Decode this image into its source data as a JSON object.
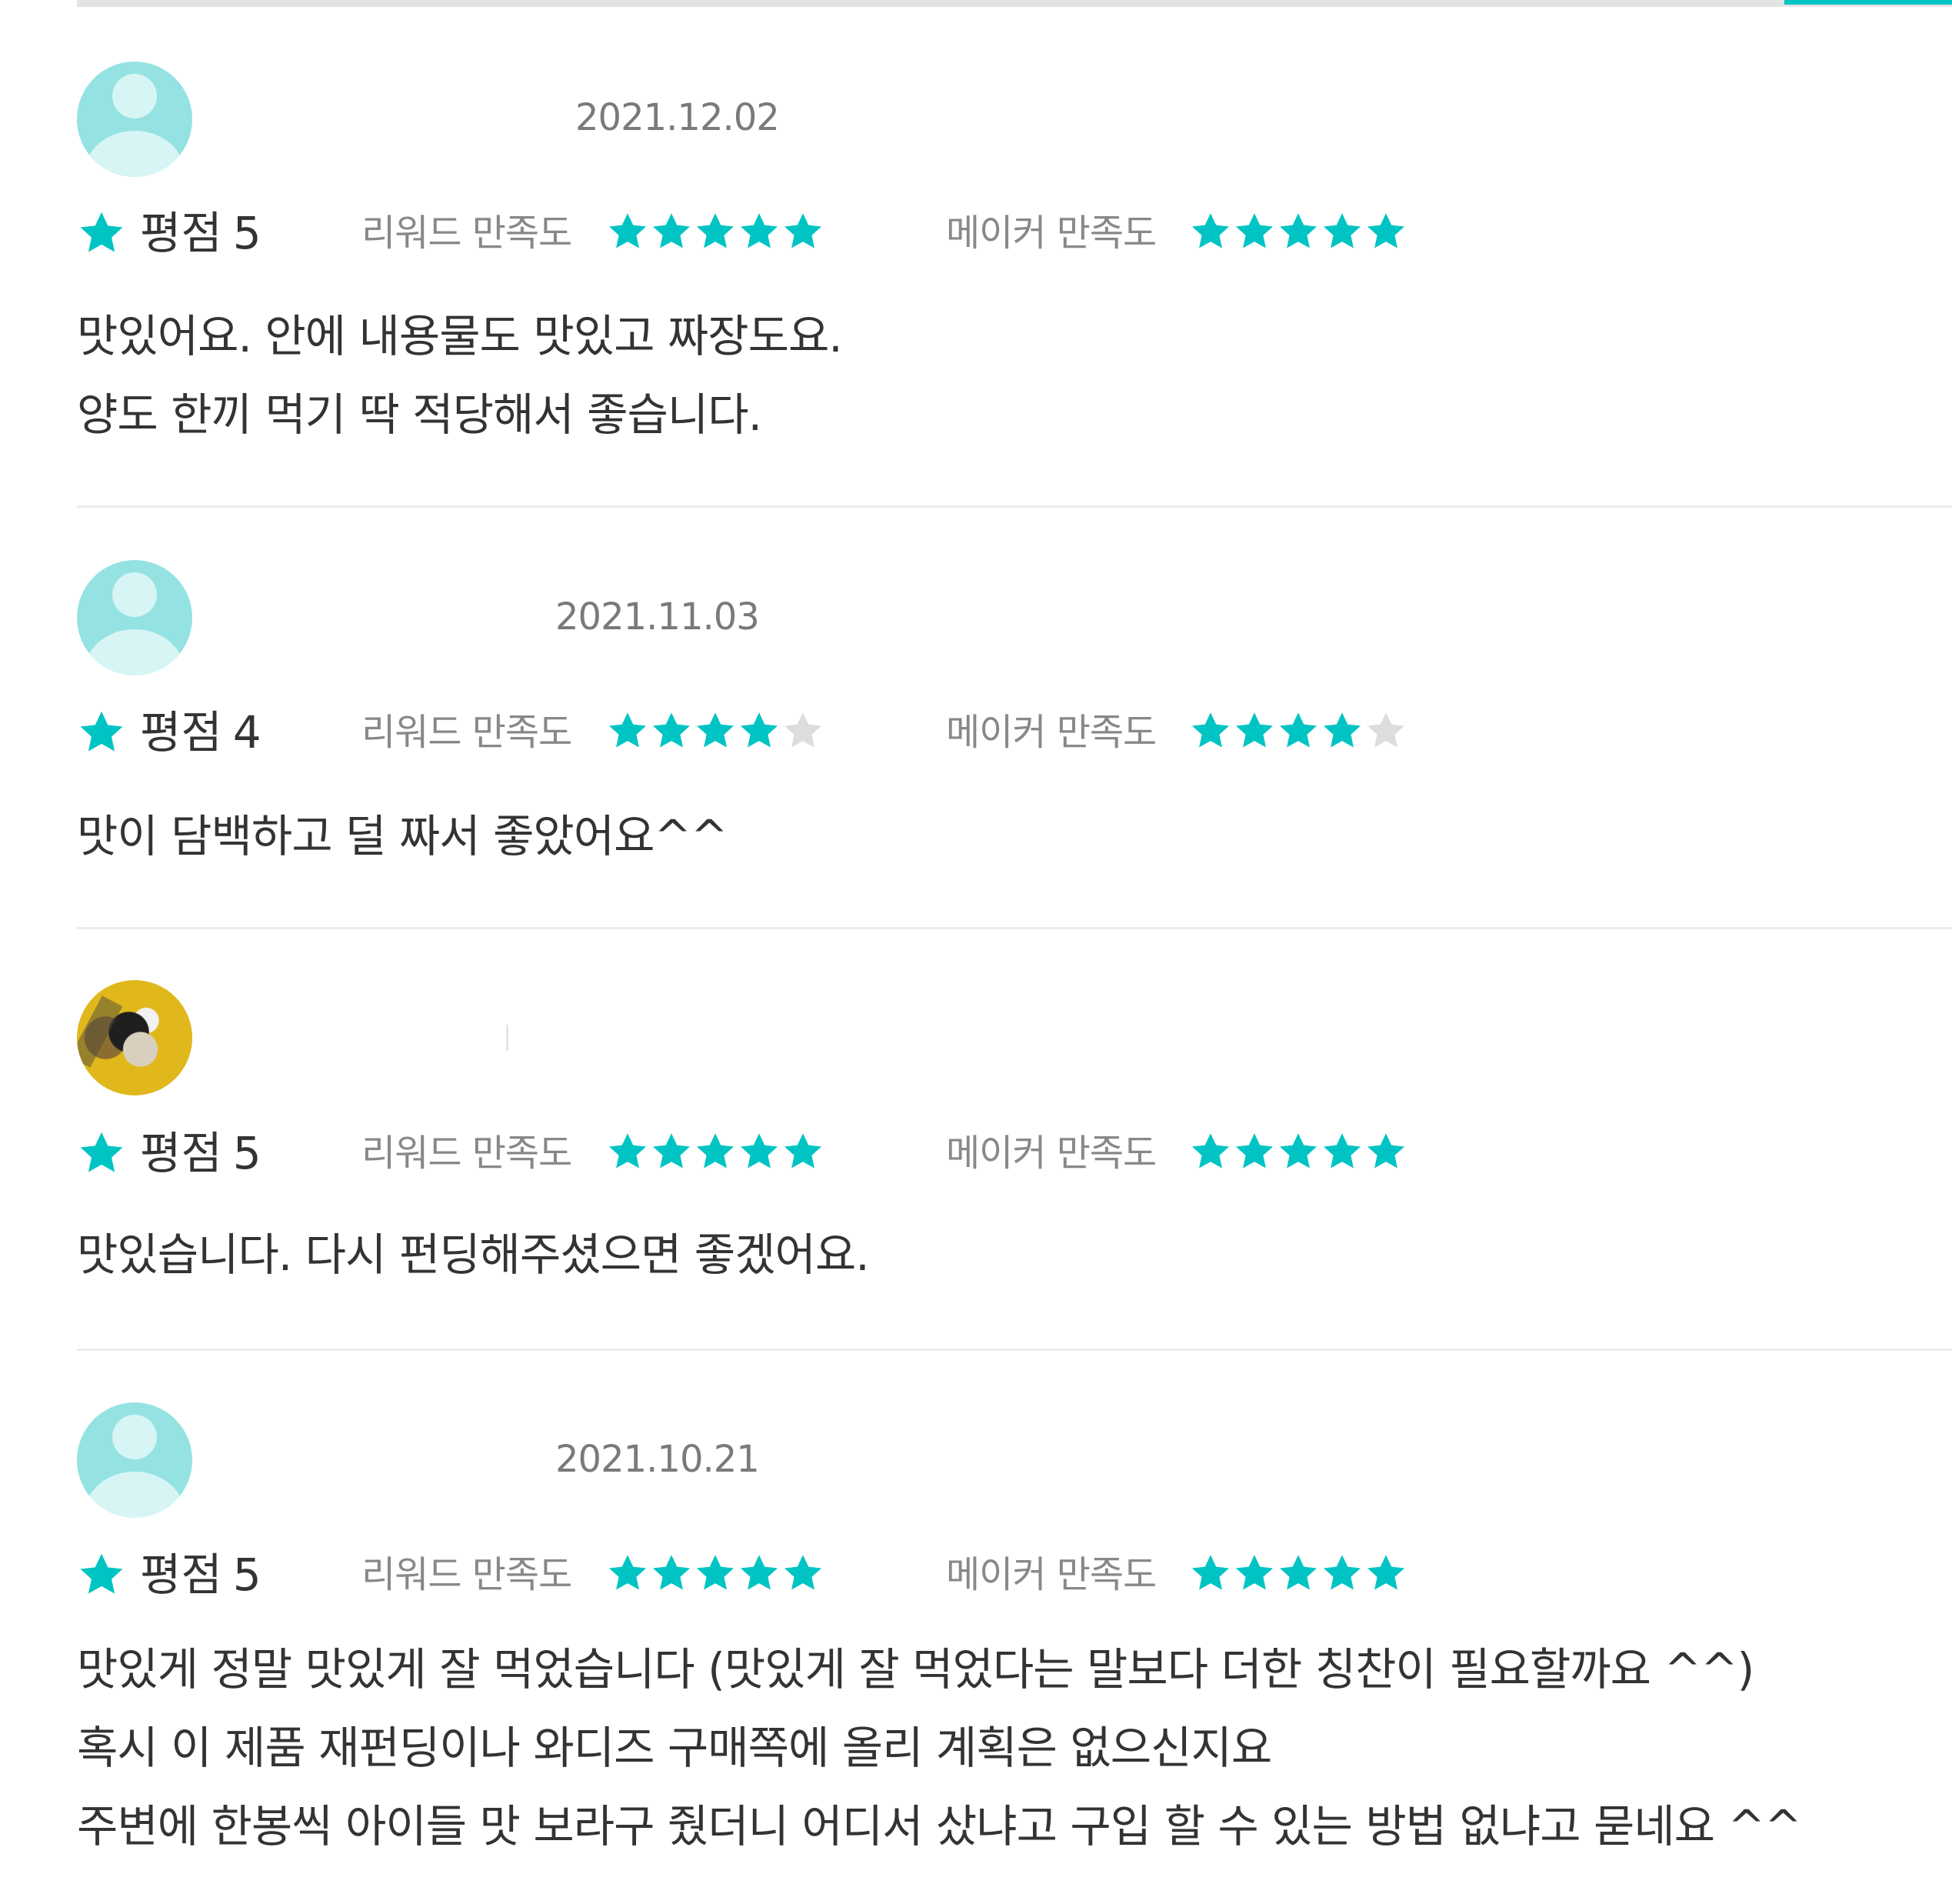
{
  "tab_indicator_color": "#00c4c4",
  "labels": {
    "rating": "평점",
    "reward_satisfaction": "리워드 만족도",
    "maker_satisfaction": "메이커 만족도"
  },
  "colors": {
    "star_filled": "#00c4c4",
    "star_empty": "#dddddd",
    "avatar_default": "#95e2e2"
  },
  "reviews": [
    {
      "avatar": "default-avatar-icon",
      "date": "2021.12.02",
      "rating": "5",
      "reward_stars": 5,
      "maker_stars": 5,
      "content": [
        "맛있어요. 안에 내용물도 맛있고 짜장도요.",
        "양도 한끼 먹기 딱 적당해서 좋습니다."
      ]
    },
    {
      "avatar": "default-avatar-icon",
      "date": "2021.11.03",
      "rating": "4",
      "reward_stars": 4,
      "maker_stars": 4,
      "content": [
        "맛이 담백하고 덜 짜서 좋았어요^^"
      ]
    },
    {
      "avatar": "user-photo-avatar",
      "date": "",
      "rating": "5",
      "reward_stars": 5,
      "maker_stars": 5,
      "content": [
        "맛있습니다. 다시 펀딩해주셨으면 좋겠어요."
      ]
    },
    {
      "avatar": "default-avatar-icon",
      "date": "2021.10.21",
      "rating": "5",
      "reward_stars": 5,
      "maker_stars": 5,
      "content": [
        "맛있게 정말 맛있게 잘 먹었습니다 (맛있게 잘 먹었다는 말보다 더한 칭찬이 필요할까요 ^^)",
        "혹시 이 제품 재펀딩이나 와디즈 구매쪽에 올리 계획은 없으신지요",
        "주변에 한봉씩 아이들 맛 보라구 줬더니 어디서 샀냐고 구입 할 수 있는 방법 없냐고 묻네요 ^^"
      ]
    }
  ]
}
